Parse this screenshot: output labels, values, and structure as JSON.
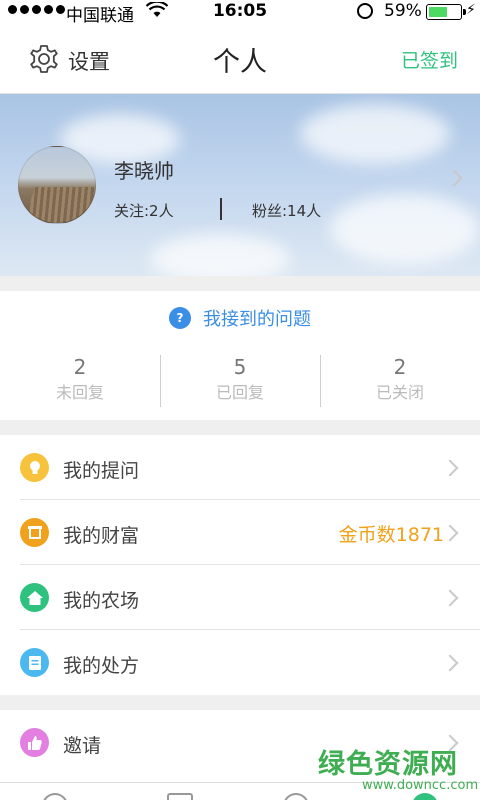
{
  "status_bar": {
    "carrier": "中国联通",
    "time": "16:05",
    "battery_percent": "59%",
    "battery_level": 0.59
  },
  "navbar": {
    "settings_label": "设置",
    "title": "个人",
    "checkin_label": "已签到"
  },
  "profile": {
    "name": "李晓帅",
    "following": "关注:2人",
    "fans": "粉丝:14人"
  },
  "questions": {
    "header": "我接到的问题",
    "stats": [
      {
        "value": "2",
        "label": "未回复"
      },
      {
        "value": "5",
        "label": "已回复"
      },
      {
        "value": "2",
        "label": "已关闭"
      }
    ]
  },
  "menu": {
    "items": [
      {
        "label": "我的提问",
        "icon": "lightbulb-icon",
        "color": "#f7c33c"
      },
      {
        "label": "我的财富",
        "icon": "wealth-icon",
        "color": "#f0a21c",
        "value": "金币数1871"
      },
      {
        "label": "我的农场",
        "icon": "home-icon",
        "color": "#2ec27e"
      },
      {
        "label": "我的处方",
        "icon": "document-icon",
        "color": "#4cb8f0"
      }
    ],
    "invite": {
      "label": "邀请",
      "icon": "thumbs-up-icon",
      "color": "#e27fe0"
    }
  },
  "watermark": {
    "main": "绿色资源网",
    "url": "www.downcc.com"
  }
}
